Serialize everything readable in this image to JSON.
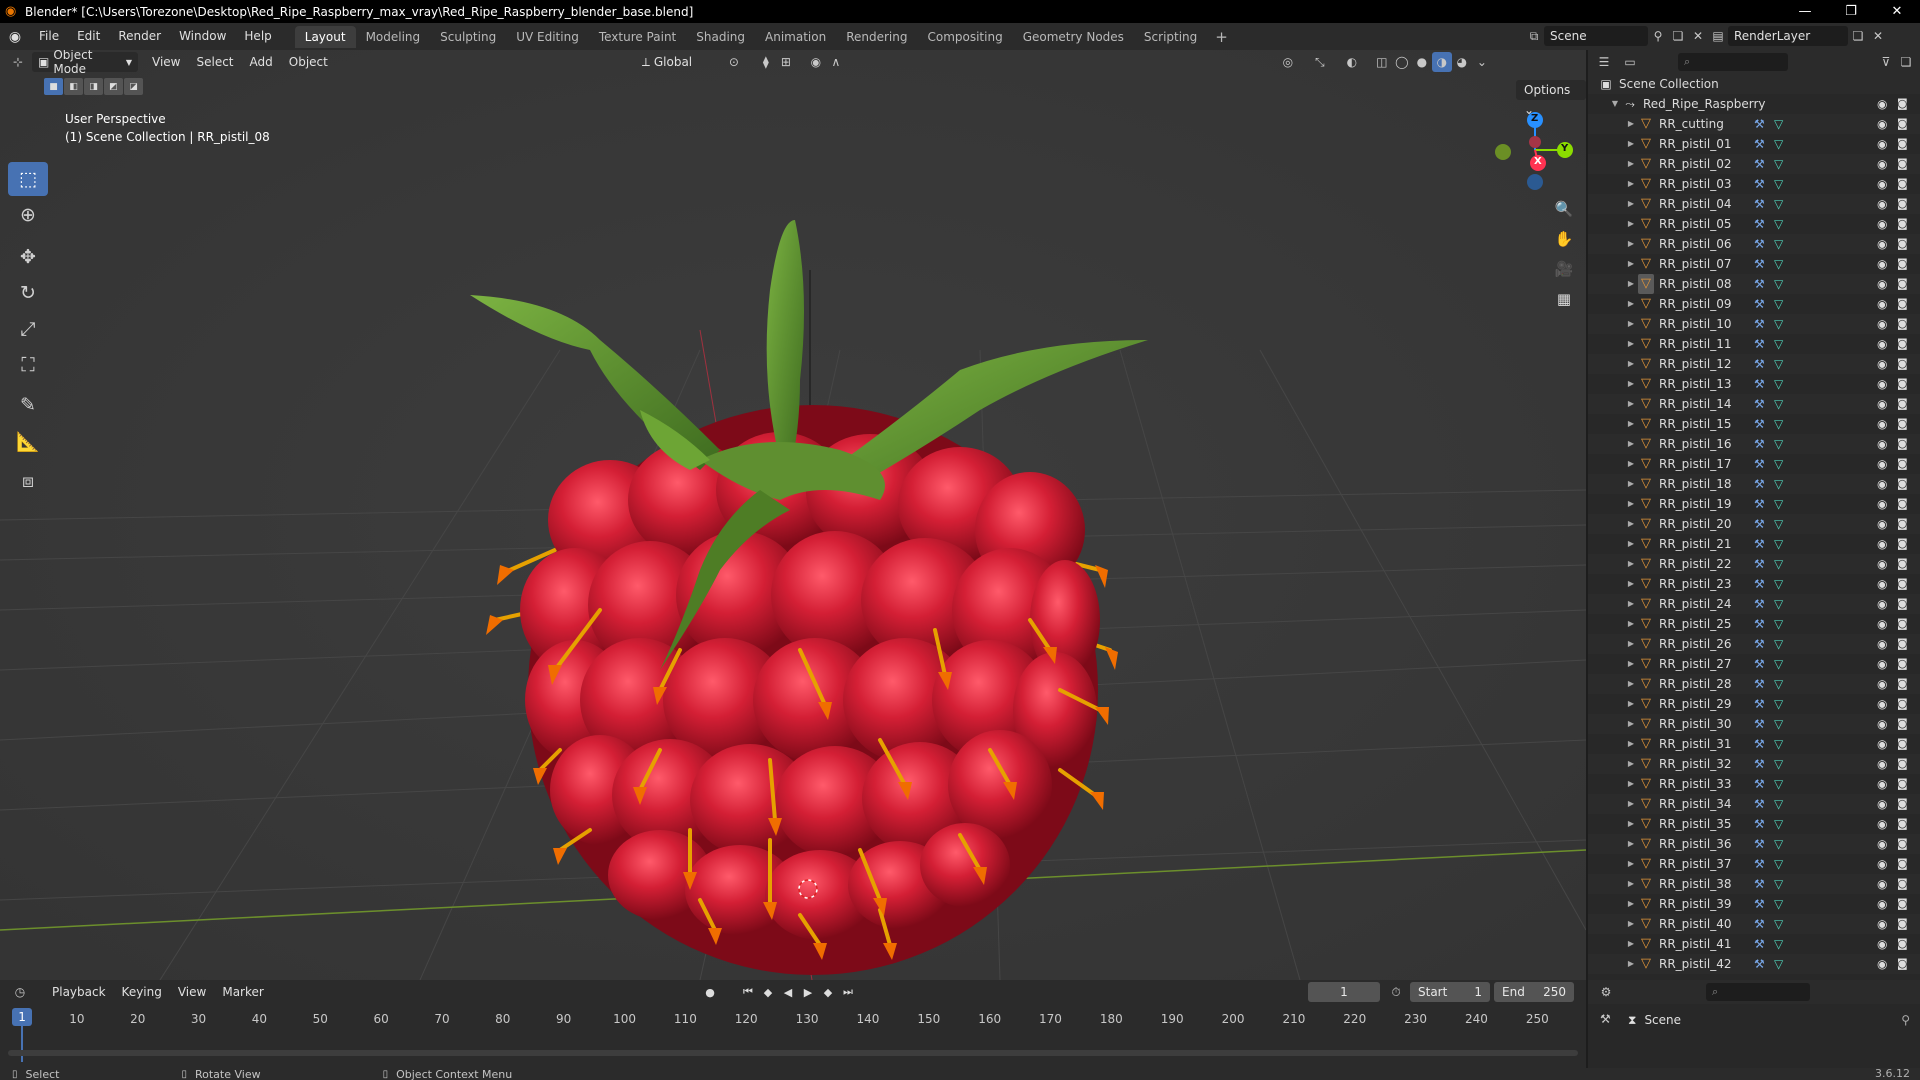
{
  "window": {
    "title": "Blender* [C:\\Users\\Torezone\\Desktop\\Red_Ripe_Raspberry_max_vray\\Red_Ripe_Raspberry_blender_base.blend]",
    "controls": [
      "—",
      "❐",
      "✕"
    ]
  },
  "menu": [
    "File",
    "Edit",
    "Render",
    "Window",
    "Help"
  ],
  "workspaces": [
    "Layout",
    "Modeling",
    "Sculpting",
    "UV Editing",
    "Texture Paint",
    "Shading",
    "Animation",
    "Rendering",
    "Compositing",
    "Geometry Nodes",
    "Scripting"
  ],
  "active_workspace": "Layout",
  "scene_name": "Scene",
  "view_layer": "RenderLayer",
  "viewport": {
    "mode": "Object Mode",
    "menus": [
      "View",
      "Select",
      "Add",
      "Object"
    ],
    "orientation": "Global",
    "options_label": "Options",
    "info_line1": "User Perspective",
    "info_line2": "(1) Scene Collection | RR_pistil_08",
    "gizmo_labels": {
      "z": "Z",
      "y": "Y",
      "x": "X"
    }
  },
  "outliner": {
    "root": "Scene Collection",
    "collection": "Red_Ripe_Raspberry",
    "objects": [
      "RR_cutting",
      "RR_pistil_01",
      "RR_pistil_02",
      "RR_pistil_03",
      "RR_pistil_04",
      "RR_pistil_05",
      "RR_pistil_06",
      "RR_pistil_07",
      "RR_pistil_08",
      "RR_pistil_09",
      "RR_pistil_10",
      "RR_pistil_11",
      "RR_pistil_12",
      "RR_pistil_13",
      "RR_pistil_14",
      "RR_pistil_15",
      "RR_pistil_16",
      "RR_pistil_17",
      "RR_pistil_18",
      "RR_pistil_19",
      "RR_pistil_20",
      "RR_pistil_21",
      "RR_pistil_22",
      "RR_pistil_23",
      "RR_pistil_24",
      "RR_pistil_25",
      "RR_pistil_26",
      "RR_pistil_27",
      "RR_pistil_28",
      "RR_pistil_29",
      "RR_pistil_30",
      "RR_pistil_31",
      "RR_pistil_32",
      "RR_pistil_33",
      "RR_pistil_34",
      "RR_pistil_35",
      "RR_pistil_36",
      "RR_pistil_37",
      "RR_pistil_38",
      "RR_pistil_39",
      "RR_pistil_40",
      "RR_pistil_41",
      "RR_pistil_42"
    ],
    "selected": "RR_pistil_08"
  },
  "timeline": {
    "menus": [
      "Playback",
      "Keying",
      "View",
      "Marker"
    ],
    "current_frame": "1",
    "start_label": "Start",
    "start": "1",
    "end_label": "End",
    "end": "250",
    "ticks": [
      "1",
      "10",
      "20",
      "30",
      "40",
      "50",
      "60",
      "70",
      "80",
      "90",
      "100",
      "110",
      "120",
      "130",
      "140",
      "150",
      "160",
      "170",
      "180",
      "190",
      "200",
      "210",
      "220",
      "230",
      "240",
      "250"
    ]
  },
  "properties": {
    "scene": "Scene"
  },
  "status": {
    "select": "Select",
    "rotate": "Rotate View",
    "context": "Object Context Menu",
    "version": "3.6.12"
  },
  "colors": {
    "accent": "#4772b3",
    "raspberry": "#d41f35",
    "leaf": "#5e9a2e",
    "pistil": "#e6a100",
    "axis_x": "#ff3352",
    "axis_y": "#8bdc00",
    "axis_z": "#2890ff"
  }
}
